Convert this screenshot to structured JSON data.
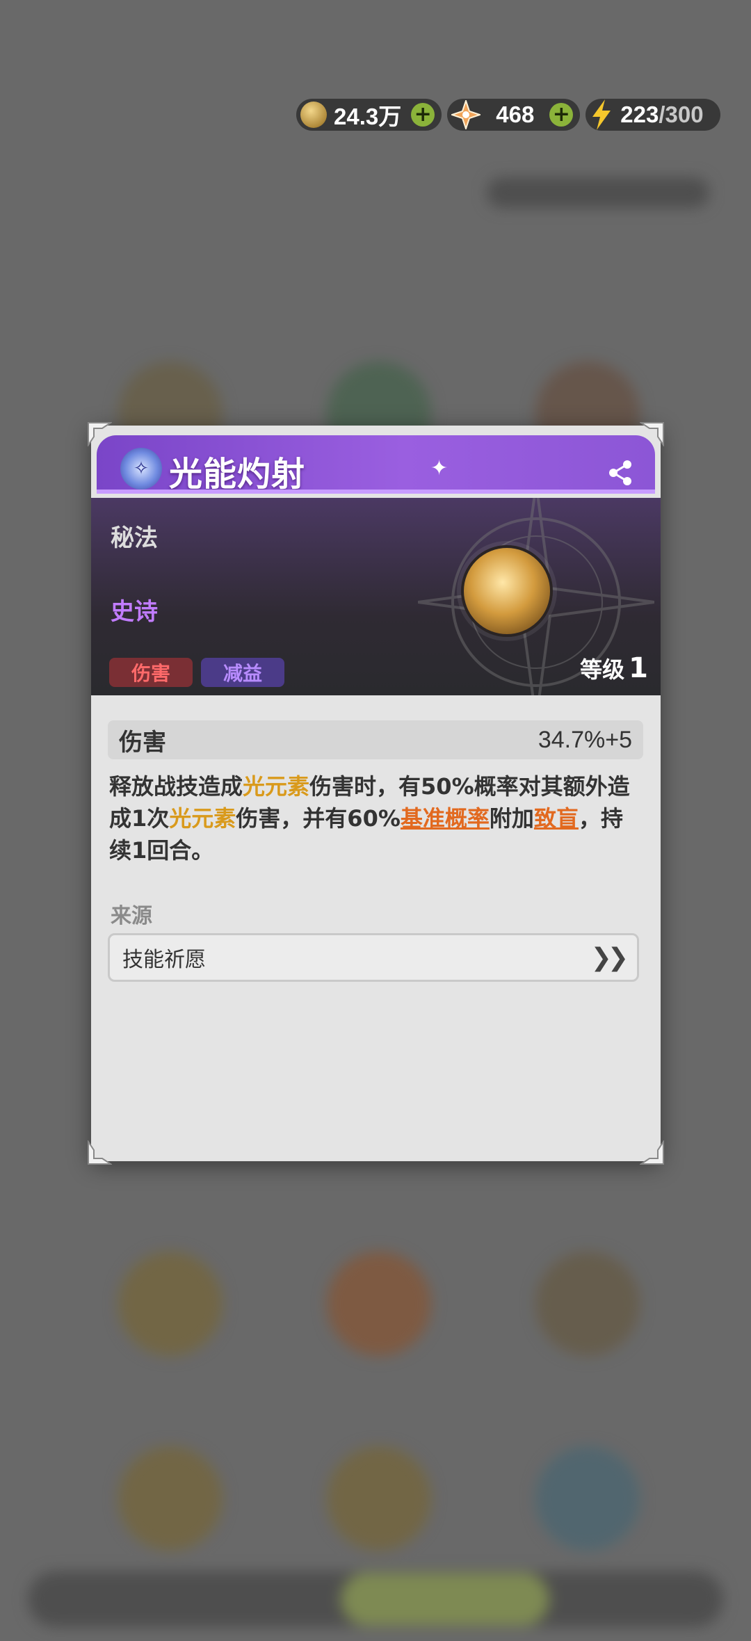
{
  "currency": [
    {
      "icon": "gold-coin-icon",
      "value": "24.3万"
    },
    {
      "icon": "diamond-star-icon",
      "value": "468"
    },
    {
      "icon": "energy-bolt-icon",
      "value": "223",
      "max": "/300"
    }
  ],
  "skill": {
    "title": "光能灼射",
    "type": "秘法",
    "rarity": "史诗",
    "tags": [
      "伤害",
      "减益"
    ],
    "level_label": "等级",
    "level": "1"
  },
  "stat": {
    "name": "伤害",
    "value": "34.7%+5"
  },
  "description": {
    "p1": "释放战技造成",
    "elem1": "光元素",
    "p2": "伤害时，有50%概率对其额外造成1次",
    "elem2": "光元素",
    "p3": "伤害，并有60%",
    "link1": "基准概率",
    "p4": "附加",
    "link2": "致盲",
    "p5": "，持续1回合。"
  },
  "source": {
    "label": "来源",
    "item": "技能祈愿"
  },
  "colors": {
    "accent": "#8c56d6",
    "highlight": "#d99a1c",
    "link": "#e2691f",
    "rarity": "#c17cff"
  }
}
